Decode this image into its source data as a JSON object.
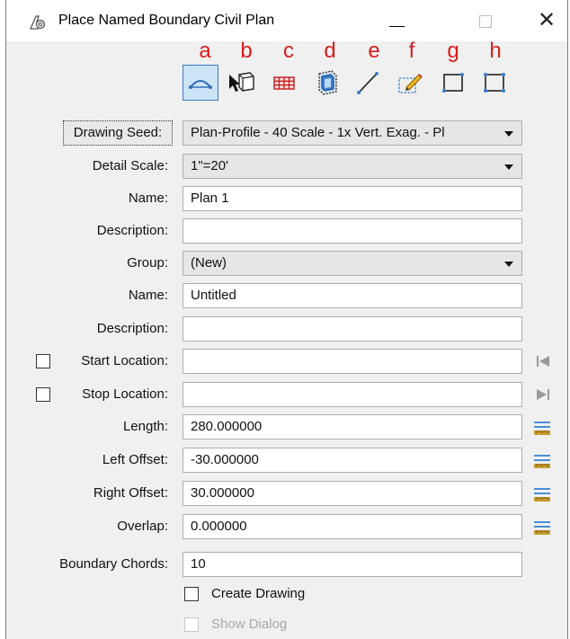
{
  "window": {
    "title": "Place Named Boundary Civil Plan",
    "close_glyph": "✕"
  },
  "toolbar": {
    "letters": [
      "a",
      "b",
      "c",
      "d",
      "e",
      "f",
      "g",
      "h"
    ],
    "letter_color": "#d81e1e",
    "tools": [
      {
        "icon": "civil-plan-icon",
        "active": true
      },
      {
        "icon": "select-element-icon"
      },
      {
        "icon": "grid-icon"
      },
      {
        "icon": "volume-icon"
      },
      {
        "icon": "line-icon"
      },
      {
        "icon": "pencil-edit-icon"
      },
      {
        "icon": "rectangle-icon"
      },
      {
        "icon": "shape-points-icon"
      }
    ]
  },
  "form": {
    "drawing_seed": {
      "label": "Drawing Seed:",
      "value": "Plan-Profile - 40 Scale - 1x Vert. Exag. - Pl"
    },
    "detail_scale": {
      "label": "Detail Scale:",
      "value": "1\"=20'"
    },
    "name": {
      "label": "Name:",
      "value": "Plan 1"
    },
    "description": {
      "label": "Description:",
      "value": ""
    },
    "group": {
      "label": "Group:",
      "value": "(New)"
    },
    "group_name": {
      "label": "Name:",
      "value": "Untitled"
    },
    "group_description": {
      "label": "Description:",
      "value": ""
    },
    "start_location": {
      "label": "Start Location:",
      "value": "",
      "checked": false
    },
    "stop_location": {
      "label": "Stop Location:",
      "value": "",
      "checked": false
    },
    "length": {
      "label": "Length:",
      "value": "280.000000"
    },
    "left_offset": {
      "label": "Left Offset:",
      "value": "-30.000000"
    },
    "right_offset": {
      "label": "Right Offset:",
      "value": "30.000000"
    },
    "overlap": {
      "label": "Overlap:",
      "value": "0.000000"
    },
    "boundary_chords": {
      "label": "Boundary Chords:",
      "value": "10"
    },
    "create_drawing": {
      "label": "Create Drawing",
      "checked": false
    },
    "show_dialog": {
      "label": "Show Dialog",
      "checked": false,
      "enabled": false
    }
  },
  "colors": {
    "accent": "#3b79c4",
    "lock_blue": "#4a8fd6",
    "lock_gold": "#c89b2e"
  }
}
